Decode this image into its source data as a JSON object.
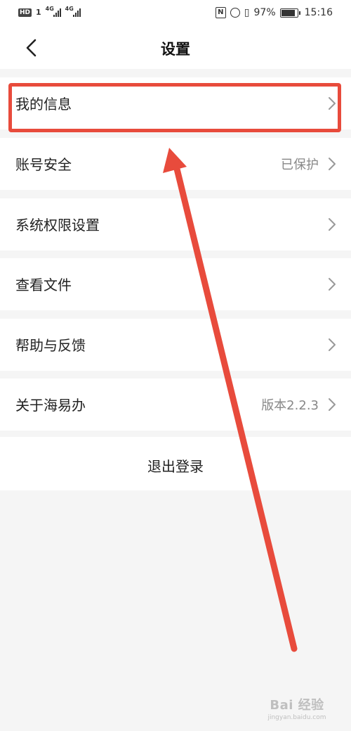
{
  "status_bar": {
    "badge": "HD",
    "sim_labels": [
      "1",
      "4G",
      "4G"
    ],
    "nfc_letter": "N",
    "battery": "97%",
    "battery_level": 0.97,
    "time": "15:16"
  },
  "header": {
    "title": "设置"
  },
  "menu": [
    {
      "label": "我的信息",
      "value": ""
    },
    {
      "label": "账号安全",
      "value": "已保护"
    },
    {
      "label": "系统权限设置",
      "value": ""
    },
    {
      "label": "查看文件",
      "value": ""
    },
    {
      "label": "帮助与反馈",
      "value": ""
    },
    {
      "label": "关于海易办",
      "value": "版本2.2.3"
    }
  ],
  "logout": {
    "label": "退出登录"
  },
  "annotation": {
    "color": "#e84b3c"
  },
  "watermark": {
    "logo_text": "Bai 经验",
    "url": "jingyan.baidu.com"
  }
}
